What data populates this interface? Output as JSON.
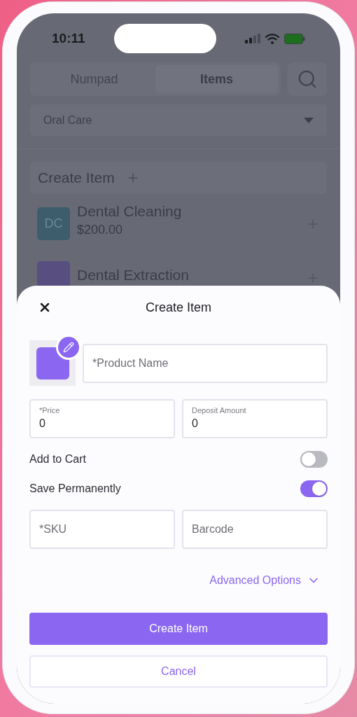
{
  "status_bar": {
    "time": "10:11"
  },
  "tabs": [
    {
      "label": "Numpad",
      "selected": false
    },
    {
      "label": "Items",
      "selected": true
    }
  ],
  "category_select": {
    "value": "Oral Care"
  },
  "create_item_row": {
    "label": "Create Item"
  },
  "items": [
    {
      "initials": "DC",
      "name": "Dental Cleaning",
      "price": "$200.00",
      "color": "#3d5d6d"
    },
    {
      "name": "Dental Extraction",
      "color": "#584e7f"
    }
  ],
  "sheet": {
    "title": "Create Item",
    "product_name": {
      "placeholder": "*Product Name"
    },
    "amount_fields": [
      {
        "label": "*Price",
        "value": "0"
      },
      {
        "label": "Deposit Amount",
        "value": "0"
      }
    ],
    "toggles": [
      {
        "label": "Add to Cart",
        "on": false
      },
      {
        "label": "Save Permanently",
        "on": true
      }
    ],
    "code_fields": [
      {
        "placeholder": "*SKU"
      },
      {
        "placeholder": "Barcode"
      }
    ],
    "advanced_options": {
      "label": "Advanced Options",
      "expanded": false
    },
    "buttons": [
      {
        "label": "Create Item",
        "kind": "primary"
      },
      {
        "label": "Cancel",
        "kind": "secondary"
      }
    ]
  }
}
